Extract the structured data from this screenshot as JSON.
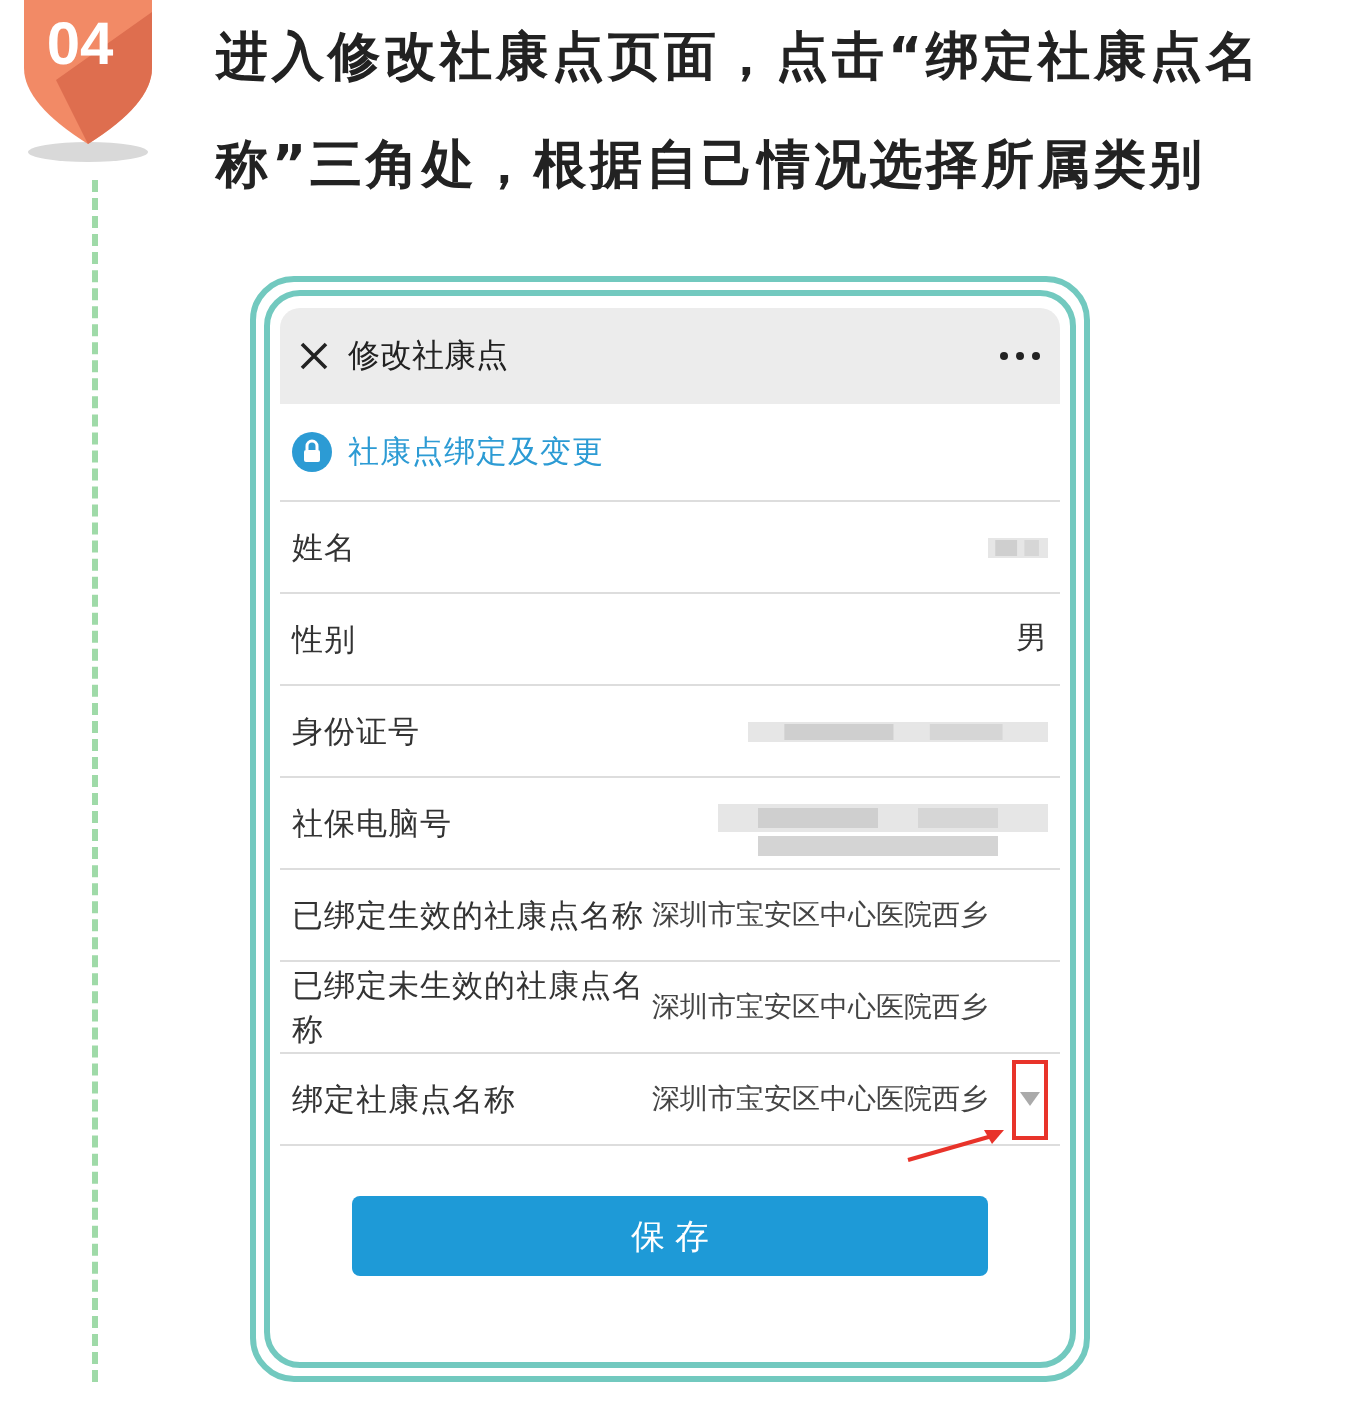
{
  "step": {
    "number": "04",
    "instruction": "进入修改社康点页面，点击“绑定社康点名称”三角处，根据自己情况选择所属类别"
  },
  "screen": {
    "title": "修改社康点",
    "banner": "社康点绑定及变更",
    "rows": [
      {
        "kind": "redacted",
        "label": "姓名"
      },
      {
        "kind": "text",
        "label": "性别",
        "value": "男"
      },
      {
        "kind": "redacted",
        "label": "身份证号"
      },
      {
        "kind": "redacted",
        "label": "社保电脑号"
      },
      {
        "kind": "text",
        "label": "已绑定生效的社康点名称",
        "value": "深圳市宝安区中心医院西乡"
      },
      {
        "kind": "text",
        "label": "已绑定未生效的社康点名称",
        "value": "深圳市宝安区中心医院西乡"
      },
      {
        "kind": "select",
        "label": "绑定社康点名称",
        "value": "深圳市宝安区中心医院西乡",
        "highlighted": true
      }
    ],
    "save_button": "保 存"
  }
}
